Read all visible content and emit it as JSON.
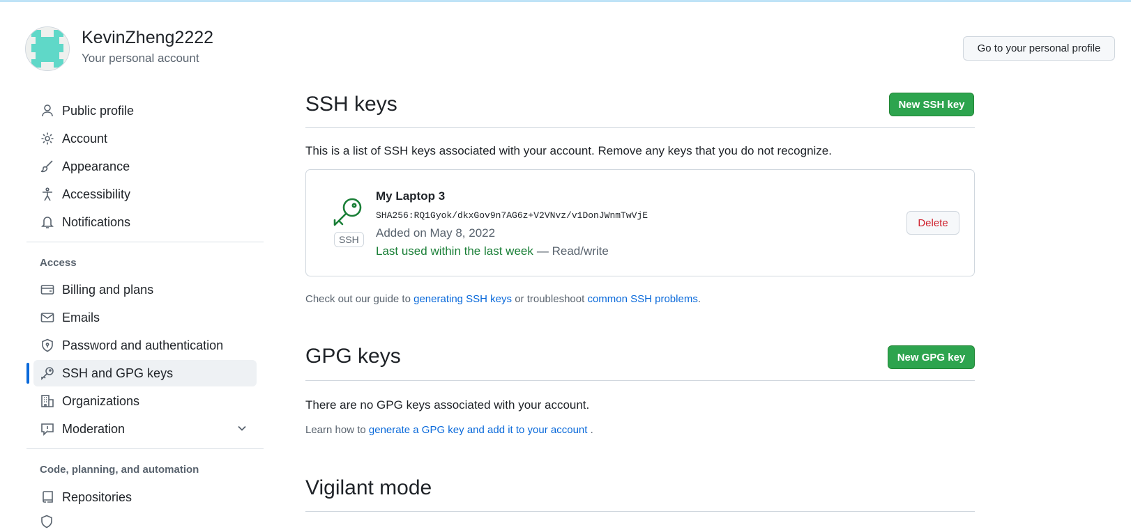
{
  "header": {
    "username": "KevinZheng2222",
    "subtitle": "Your personal account",
    "profile_button": "Go to your personal profile"
  },
  "sidebar": {
    "items": [
      {
        "label": "Public profile",
        "icon": "person-icon"
      },
      {
        "label": "Account",
        "icon": "gear-icon"
      },
      {
        "label": "Appearance",
        "icon": "paintbrush-icon"
      },
      {
        "label": "Accessibility",
        "icon": "accessibility-icon"
      },
      {
        "label": "Notifications",
        "icon": "bell-icon"
      }
    ],
    "access_heading": "Access",
    "access_items": [
      {
        "label": "Billing and plans",
        "icon": "credit-card-icon"
      },
      {
        "label": "Emails",
        "icon": "mail-icon"
      },
      {
        "label": "Password and authentication",
        "icon": "shield-lock-icon"
      },
      {
        "label": "SSH and GPG keys",
        "icon": "key-icon",
        "active": true
      },
      {
        "label": "Organizations",
        "icon": "organization-icon"
      },
      {
        "label": "Moderation",
        "icon": "report-icon"
      }
    ],
    "code_heading": "Code, planning, and automation",
    "code_items": [
      {
        "label": "Repositories",
        "icon": "repo-icon"
      }
    ]
  },
  "ssh": {
    "title": "SSH keys",
    "new_button": "New SSH key",
    "intro": "This is a list of SSH keys associated with your account. Remove any keys that you do not recognize.",
    "key": {
      "name": "My Laptop 3",
      "fingerprint": "SHA256:RQ1Gyok/dkxGov9n7AG6z+V2VNvz/v1DonJWnmTwVjE",
      "added": "Added on May 8, 2022",
      "last_used": "Last used within the last week",
      "access": "— Read/write",
      "badge": "SSH",
      "delete_button": "Delete"
    },
    "guide_prefix": "Check out our guide to ",
    "guide_link1": "generating SSH keys",
    "guide_middle": " or troubleshoot ",
    "guide_link2": "common SSH problems",
    "guide_suffix": "."
  },
  "gpg": {
    "title": "GPG keys",
    "new_button": "New GPG key",
    "empty": "There are no GPG keys associated with your account.",
    "learn_prefix": "Learn how to ",
    "learn_link": "generate a GPG key and add it to your account",
    "learn_suffix": " ."
  },
  "vigilant": {
    "title": "Vigilant mode"
  },
  "colors": {
    "accent": "#0969da",
    "green": "#2da44e",
    "danger": "#cf222e",
    "last_used": "#1a7f37"
  }
}
